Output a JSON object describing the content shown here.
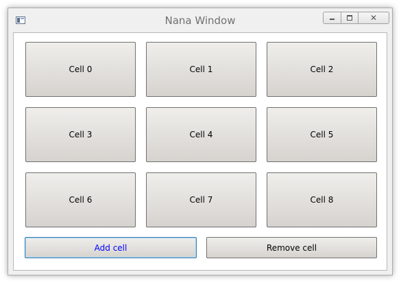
{
  "window": {
    "title": "Nana Window",
    "controls": {
      "minimize": "minimize",
      "maximize": "maximize",
      "close": "close"
    }
  },
  "grid": {
    "cells": [
      {
        "label": "Cell 0"
      },
      {
        "label": "Cell 1"
      },
      {
        "label": "Cell 2"
      },
      {
        "label": "Cell 3"
      },
      {
        "label": "Cell 4"
      },
      {
        "label": "Cell 5"
      },
      {
        "label": "Cell 6"
      },
      {
        "label": "Cell 7"
      },
      {
        "label": "Cell 8"
      }
    ]
  },
  "actions": {
    "add_label": "Add cell",
    "remove_label": "Remove cell"
  },
  "colors": {
    "focused_text": "#0000ff",
    "focus_border": "#3c7fb1"
  }
}
